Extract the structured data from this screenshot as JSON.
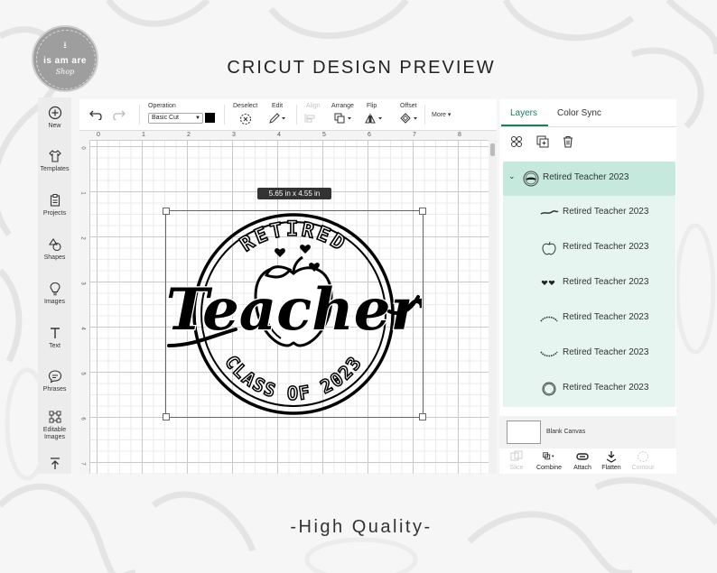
{
  "page": {
    "title": "CRICUT DESIGN PREVIEW",
    "footer": "-High Quality-",
    "logo": {
      "name": "is am are",
      "script": "Shop",
      "icon": "download-icon"
    }
  },
  "left_sidebar": {
    "items": [
      {
        "label": "New",
        "icon": "plus-circle-icon"
      },
      {
        "label": "Templates",
        "icon": "shirt-icon"
      },
      {
        "label": "Projects",
        "icon": "clipboard-icon"
      },
      {
        "label": "Shapes",
        "icon": "shapes-icon"
      },
      {
        "label": "Images",
        "icon": "lightbulb-icon"
      },
      {
        "label": "Text",
        "icon": "text-icon"
      },
      {
        "label": "Phrases",
        "icon": "speech-bubble-icon"
      },
      {
        "label": "Editable Images",
        "icon": "vector-edit-icon"
      }
    ]
  },
  "toolbar": {
    "operation_label": "Operation",
    "operation_value": "Basic Cut",
    "swatch_color": "#000000",
    "deselect_label": "Deselect",
    "edit_label": "Edit",
    "align_label": "Align",
    "arrange_label": "Arrange",
    "flip_label": "Flip",
    "offset_label": "Offset",
    "more_label": "More"
  },
  "canvas": {
    "ruler_top": [
      "0",
      "1",
      "2",
      "3",
      "4",
      "5",
      "6",
      "7",
      "8"
    ],
    "ruler_left": [
      "0",
      "1",
      "2",
      "3",
      "4",
      "5",
      "6",
      "7"
    ],
    "dimension_tag": "5.65  in x 4.55  in"
  },
  "design": {
    "line1": "RETIRED",
    "line2": "Teacher",
    "line3": "CLASS OF 2023"
  },
  "panel": {
    "tabs": [
      "Layers",
      "Color Sync"
    ],
    "active_tab": "Layers",
    "accent_color": "#1a7f5a",
    "group": {
      "name": "Retired Teacher 2023",
      "icon": "group-thumb-icon"
    },
    "layers": [
      {
        "name": "Retired Teacher 2023",
        "icon": "teacher-script-thumb-icon"
      },
      {
        "name": "Retired Teacher 2023",
        "icon": "apple-thumb-icon"
      },
      {
        "name": "Retired Teacher 2023",
        "icon": "hearts-thumb-icon"
      },
      {
        "name": "Retired Teacher 2023",
        "icon": "arc-text-thumb-icon"
      },
      {
        "name": "Retired Teacher 2023",
        "icon": "arc-text-bottom-thumb-icon"
      },
      {
        "name": "Retired Teacher 2023",
        "icon": "ring-thumb-icon"
      }
    ],
    "blank_canvas_label": "Blank Canvas",
    "bottom_tools": [
      {
        "label": "Slice",
        "enabled": false
      },
      {
        "label": "Combine",
        "enabled": true
      },
      {
        "label": "Attach",
        "enabled": true
      },
      {
        "label": "Flatten",
        "enabled": true
      },
      {
        "label": "Contour",
        "enabled": false
      }
    ]
  }
}
